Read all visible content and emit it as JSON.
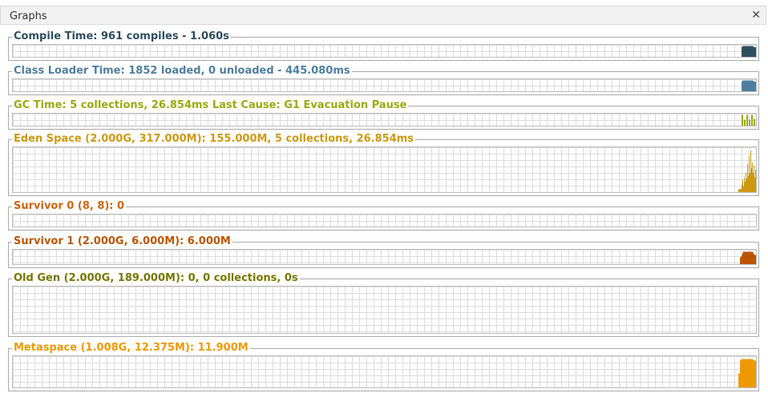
{
  "panel": {
    "title": "Graphs",
    "close_icon": "close-icon"
  },
  "graphs": [
    {
      "id": "compile-time",
      "label": "Compile Time: 961 compiles - 1.060s",
      "color": "#2f4f5f",
      "level": 1.0
    },
    {
      "id": "class-loader-time",
      "label": "Class Loader Time: 1852 loaded, 0 unloaded - 445.080ms",
      "color": "#4f7f9f",
      "level": 1.0
    },
    {
      "id": "gc-time",
      "label": "GC Time: 5 collections, 26.854ms Last Cause: G1 Evacuation Pause",
      "color": "#99aa11",
      "level": 1.0
    },
    {
      "id": "eden-space",
      "label": "Eden Space (2.000G, 317.000M): 155.000M, 5 collections, 26.854ms",
      "color": "#cc9911",
      "level": 0.9
    },
    {
      "id": "survivor-0",
      "label": "Survivor 0 (8, 8): 0",
      "color": "#cc6611",
      "level": 0
    },
    {
      "id": "survivor-1",
      "label": "Survivor 1 (2.000G, 6.000M): 6.000M",
      "color": "#bb5500",
      "level": 1.0
    },
    {
      "id": "old-gen",
      "label": "Old Gen (2.000G, 189.000M): 0, 0 collections, 0s",
      "color": "#777700",
      "level": 0
    },
    {
      "id": "metaspace",
      "label": "Metaspace (1.008G, 12.375M): 11.900M",
      "color": "#ee9900",
      "level": 0.96
    }
  ]
}
